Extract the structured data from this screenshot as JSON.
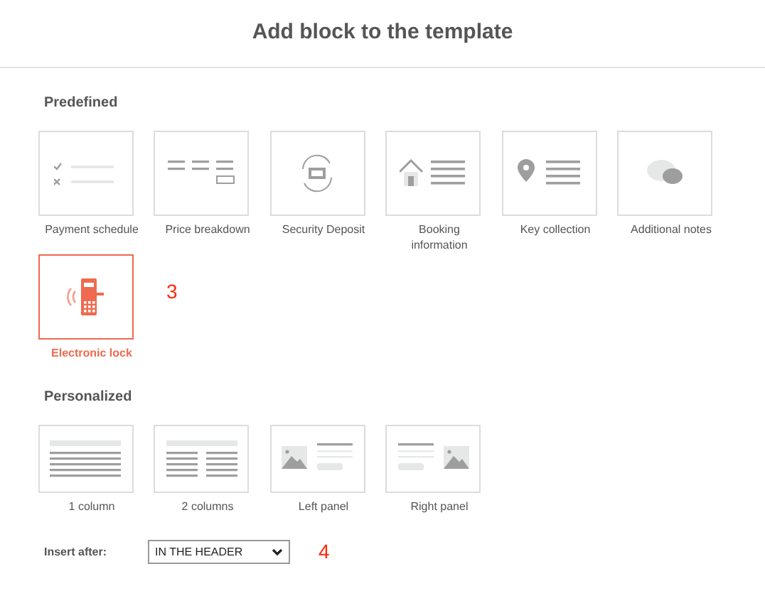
{
  "dialog": {
    "title": "Add block to the template"
  },
  "predefined": {
    "heading": "Predefined",
    "items": [
      {
        "label": "Payment schedule",
        "kind": "checklist",
        "selected": false
      },
      {
        "label": "Price breakdown",
        "kind": "price",
        "selected": false
      },
      {
        "label": "Security Deposit",
        "kind": "deposit",
        "selected": false
      },
      {
        "label": "Booking information",
        "kind": "house",
        "selected": false
      },
      {
        "label": "Key collection",
        "kind": "pin",
        "selected": false
      },
      {
        "label": "Additional notes",
        "kind": "chat",
        "selected": false
      },
      {
        "label": "Electronic lock",
        "kind": "lock",
        "selected": true,
        "annotation": "3"
      }
    ]
  },
  "personalized": {
    "heading": "Personalized",
    "items": [
      {
        "label": "1 column",
        "kind": "one-column",
        "selected": false
      },
      {
        "label": "2 columns",
        "kind": "two-columns",
        "selected": false
      },
      {
        "label": "Left panel",
        "kind": "left-panel",
        "selected": false
      },
      {
        "label": "Right panel",
        "kind": "right-panel",
        "selected": false
      }
    ]
  },
  "insert_after": {
    "label": "Insert after:",
    "value": "IN THE HEADER",
    "annotation": "4"
  }
}
